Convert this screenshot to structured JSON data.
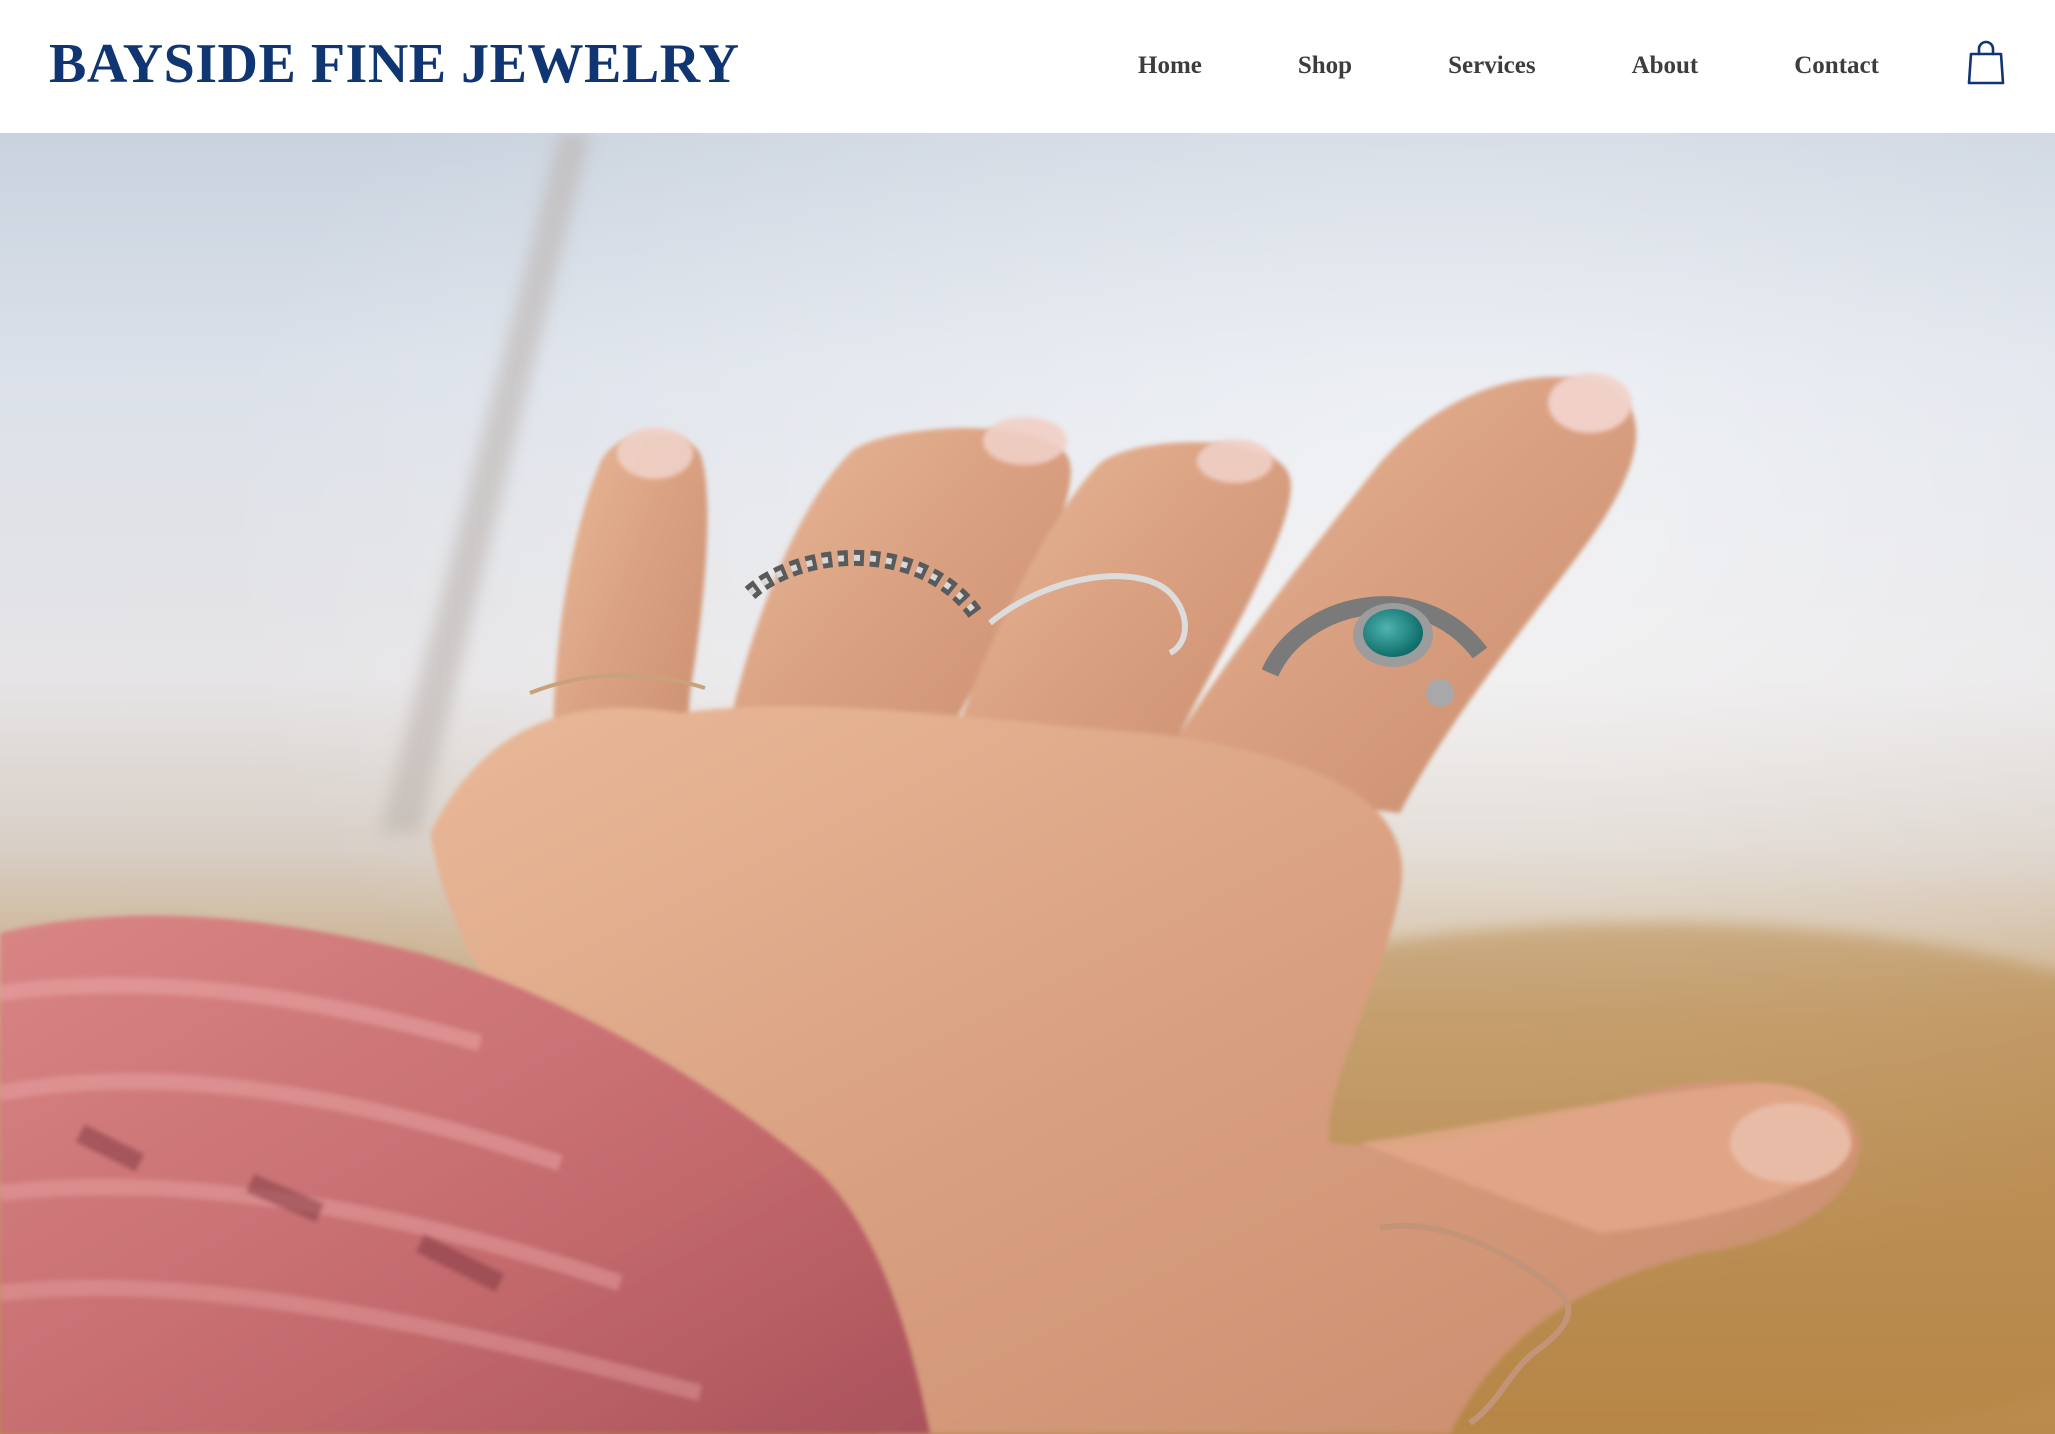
{
  "brand": {
    "name": "BAYSIDE FINE JEWELRY",
    "color": "#0f3572"
  },
  "nav": {
    "items": [
      {
        "label": "Home"
      },
      {
        "label": "Shop"
      },
      {
        "label": "Services"
      },
      {
        "label": "About"
      },
      {
        "label": "Contact"
      }
    ],
    "text_color": "#3d3d3d"
  },
  "cart": {
    "icon": "shopping-bag-icon"
  },
  "hero": {
    "image": "photo-hand-with-rings",
    "description_icon": "hero-image"
  }
}
